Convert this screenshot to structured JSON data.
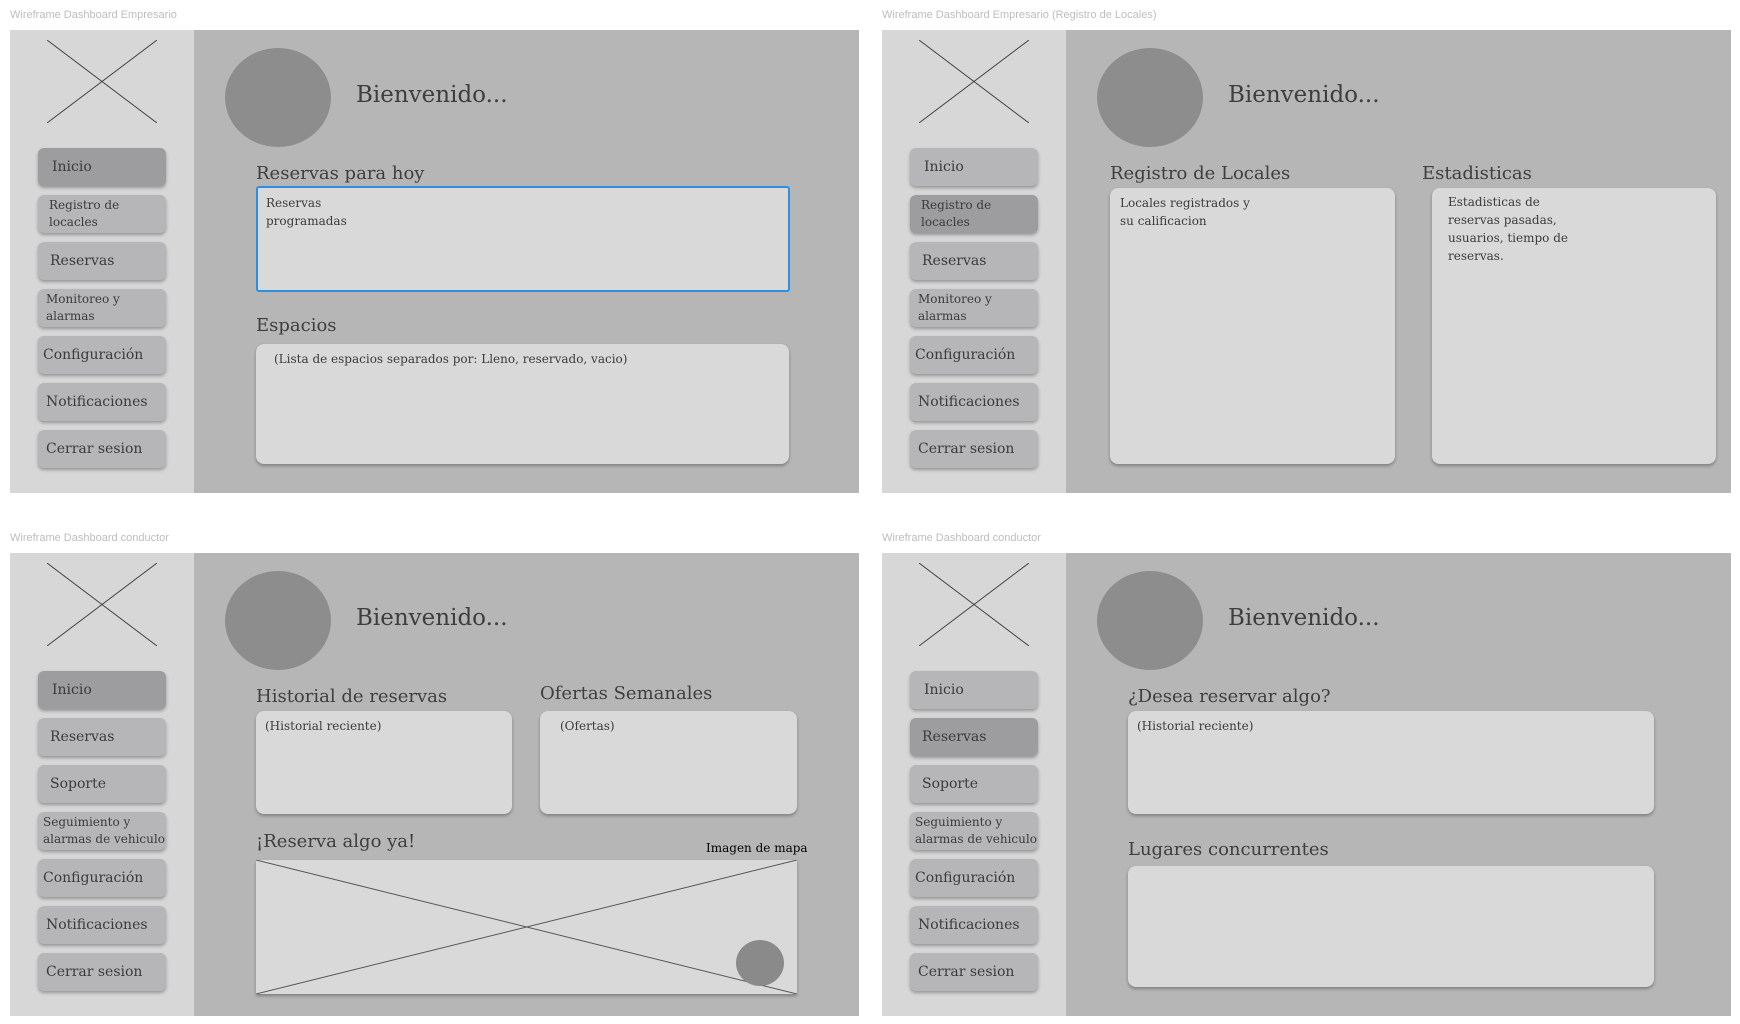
{
  "frames": [
    {
      "title": "Wireframe Dashboard Empresario",
      "nav": [
        "Inicio",
        "Registro de locacles",
        "Reservas",
        "Monitoreo y alarmas",
        "Configuración",
        "Notificaciones",
        "Cerrar sesion"
      ],
      "active_nav": "Inicio",
      "welcome": "Bienvenido...",
      "reservas_hoy": {
        "heading": "Reservas para hoy",
        "text": "Reservas\nprogramadas"
      },
      "espacios": {
        "heading": "Espacios",
        "text": "(Lista de espacios separados por: Lleno, reservado, vacio)"
      }
    },
    {
      "title": "Wireframe Dashboard Empresario (Registro de Locales)",
      "nav": [
        "Inicio",
        "Registro de locacles",
        "Reservas",
        "Monitoreo y alarmas",
        "Configuración",
        "Notificaciones",
        "Cerrar sesion"
      ],
      "active_nav": "Registro de locacles",
      "welcome": "Bienvenido...",
      "registro": {
        "heading": "Registro de Locales",
        "text": "Locales registrados y\nsu calificacion"
      },
      "estadisticas": {
        "heading": "Estadisticas",
        "text": "Estadisticas de\nreservas pasadas,\nusuarios, tiempo de\nreservas."
      }
    },
    {
      "title": "Wireframe Dashboard conductor",
      "nav": [
        "Inicio",
        "Reservas",
        "Soporte",
        "Seguimiento y alarmas de vehiculo",
        "Configuración",
        "Notificaciones",
        "Cerrar sesion"
      ],
      "active_nav": "Inicio",
      "welcome": "Bienvenido...",
      "historial": {
        "heading": "Historial de reservas",
        "text": "(Historial reciente)"
      },
      "ofertas": {
        "heading": "Ofertas Semanales",
        "text": "(Ofertas)"
      },
      "reserva_ya": {
        "heading": "¡Reserva algo ya!",
        "map_label": "Imagen de mapa"
      }
    },
    {
      "title": "Wireframe Dashboard conductor",
      "nav": [
        "Inicio",
        "Reservas",
        "Soporte",
        "Seguimiento y alarmas de vehiculo",
        "Configuración",
        "Notificaciones",
        "Cerrar sesion"
      ],
      "active_nav": "Reservas",
      "welcome": "Bienvenido...",
      "desea": {
        "heading": "¿Desea reservar algo?",
        "text": "(Historial reciente)"
      },
      "lugares": {
        "heading": "Lugares concurrentes"
      }
    }
  ],
  "colors": {
    "frame_bg": "#b6b6b6",
    "sidebar_bg": "#d7d7d7",
    "nav_bg": "#b6b5b7",
    "nav_active_bg": "#9d9c9e",
    "card_bg": "#d9d9d9",
    "avatar": "#8d8d8d",
    "selection": "#2d8fdd"
  },
  "icons": [
    "logo-placeholder-x",
    "avatar-circle",
    "map-placeholder-x",
    "map-pin-circle"
  ]
}
